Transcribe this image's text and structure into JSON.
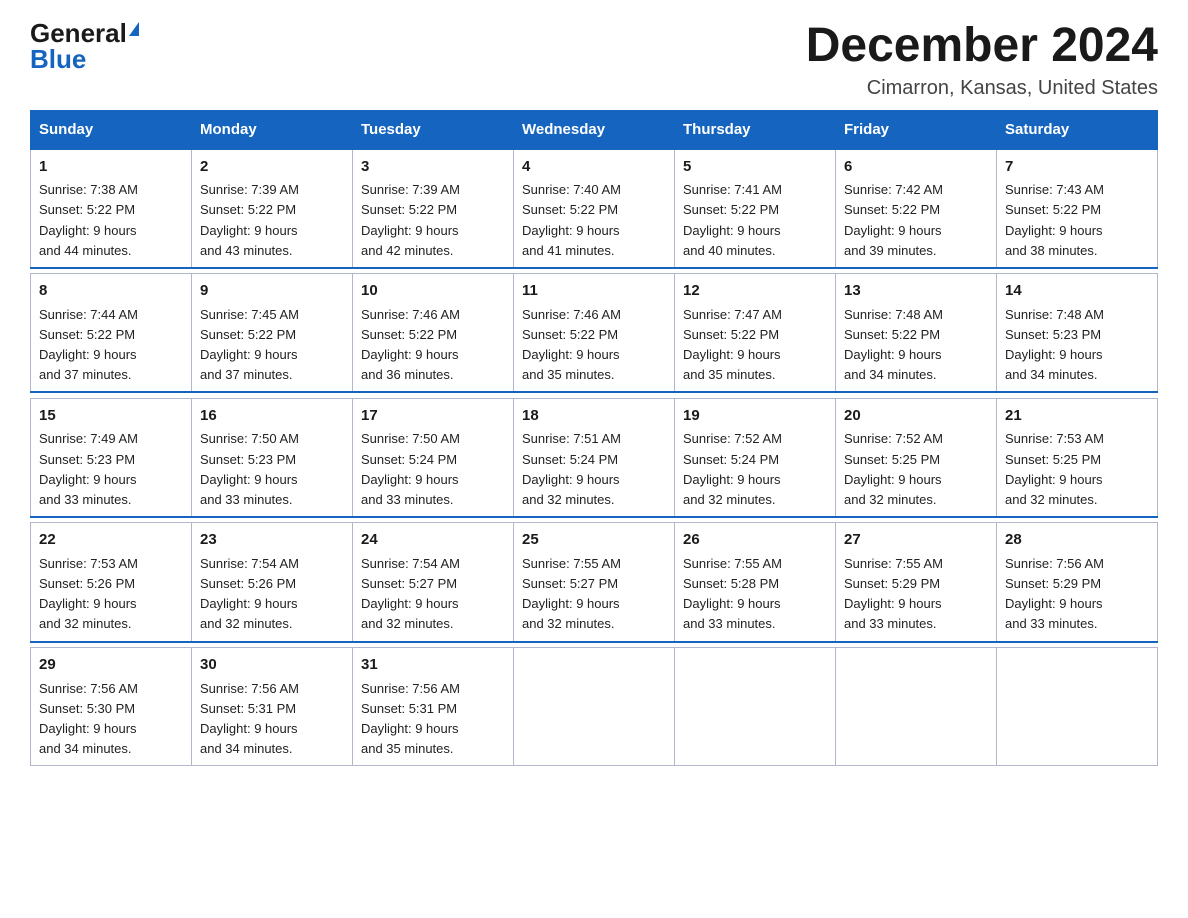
{
  "header": {
    "logo": {
      "general": "General",
      "blue": "Blue"
    },
    "title": "December 2024",
    "location": "Cimarron, Kansas, United States"
  },
  "days_of_week": [
    "Sunday",
    "Monday",
    "Tuesday",
    "Wednesday",
    "Thursday",
    "Friday",
    "Saturday"
  ],
  "weeks": [
    [
      {
        "day": "1",
        "sunrise": "7:38 AM",
        "sunset": "5:22 PM",
        "daylight": "9 hours and 44 minutes."
      },
      {
        "day": "2",
        "sunrise": "7:39 AM",
        "sunset": "5:22 PM",
        "daylight": "9 hours and 43 minutes."
      },
      {
        "day": "3",
        "sunrise": "7:39 AM",
        "sunset": "5:22 PM",
        "daylight": "9 hours and 42 minutes."
      },
      {
        "day": "4",
        "sunrise": "7:40 AM",
        "sunset": "5:22 PM",
        "daylight": "9 hours and 41 minutes."
      },
      {
        "day": "5",
        "sunrise": "7:41 AM",
        "sunset": "5:22 PM",
        "daylight": "9 hours and 40 minutes."
      },
      {
        "day": "6",
        "sunrise": "7:42 AM",
        "sunset": "5:22 PM",
        "daylight": "9 hours and 39 minutes."
      },
      {
        "day": "7",
        "sunrise": "7:43 AM",
        "sunset": "5:22 PM",
        "daylight": "9 hours and 38 minutes."
      }
    ],
    [
      {
        "day": "8",
        "sunrise": "7:44 AM",
        "sunset": "5:22 PM",
        "daylight": "9 hours and 37 minutes."
      },
      {
        "day": "9",
        "sunrise": "7:45 AM",
        "sunset": "5:22 PM",
        "daylight": "9 hours and 37 minutes."
      },
      {
        "day": "10",
        "sunrise": "7:46 AM",
        "sunset": "5:22 PM",
        "daylight": "9 hours and 36 minutes."
      },
      {
        "day": "11",
        "sunrise": "7:46 AM",
        "sunset": "5:22 PM",
        "daylight": "9 hours and 35 minutes."
      },
      {
        "day": "12",
        "sunrise": "7:47 AM",
        "sunset": "5:22 PM",
        "daylight": "9 hours and 35 minutes."
      },
      {
        "day": "13",
        "sunrise": "7:48 AM",
        "sunset": "5:22 PM",
        "daylight": "9 hours and 34 minutes."
      },
      {
        "day": "14",
        "sunrise": "7:48 AM",
        "sunset": "5:23 PM",
        "daylight": "9 hours and 34 minutes."
      }
    ],
    [
      {
        "day": "15",
        "sunrise": "7:49 AM",
        "sunset": "5:23 PM",
        "daylight": "9 hours and 33 minutes."
      },
      {
        "day": "16",
        "sunrise": "7:50 AM",
        "sunset": "5:23 PM",
        "daylight": "9 hours and 33 minutes."
      },
      {
        "day": "17",
        "sunrise": "7:50 AM",
        "sunset": "5:24 PM",
        "daylight": "9 hours and 33 minutes."
      },
      {
        "day": "18",
        "sunrise": "7:51 AM",
        "sunset": "5:24 PM",
        "daylight": "9 hours and 32 minutes."
      },
      {
        "day": "19",
        "sunrise": "7:52 AM",
        "sunset": "5:24 PM",
        "daylight": "9 hours and 32 minutes."
      },
      {
        "day": "20",
        "sunrise": "7:52 AM",
        "sunset": "5:25 PM",
        "daylight": "9 hours and 32 minutes."
      },
      {
        "day": "21",
        "sunrise": "7:53 AM",
        "sunset": "5:25 PM",
        "daylight": "9 hours and 32 minutes."
      }
    ],
    [
      {
        "day": "22",
        "sunrise": "7:53 AM",
        "sunset": "5:26 PM",
        "daylight": "9 hours and 32 minutes."
      },
      {
        "day": "23",
        "sunrise": "7:54 AM",
        "sunset": "5:26 PM",
        "daylight": "9 hours and 32 minutes."
      },
      {
        "day": "24",
        "sunrise": "7:54 AM",
        "sunset": "5:27 PM",
        "daylight": "9 hours and 32 minutes."
      },
      {
        "day": "25",
        "sunrise": "7:55 AM",
        "sunset": "5:27 PM",
        "daylight": "9 hours and 32 minutes."
      },
      {
        "day": "26",
        "sunrise": "7:55 AM",
        "sunset": "5:28 PM",
        "daylight": "9 hours and 33 minutes."
      },
      {
        "day": "27",
        "sunrise": "7:55 AM",
        "sunset": "5:29 PM",
        "daylight": "9 hours and 33 minutes."
      },
      {
        "day": "28",
        "sunrise": "7:56 AM",
        "sunset": "5:29 PM",
        "daylight": "9 hours and 33 minutes."
      }
    ],
    [
      {
        "day": "29",
        "sunrise": "7:56 AM",
        "sunset": "5:30 PM",
        "daylight": "9 hours and 34 minutes."
      },
      {
        "day": "30",
        "sunrise": "7:56 AM",
        "sunset": "5:31 PM",
        "daylight": "9 hours and 34 minutes."
      },
      {
        "day": "31",
        "sunrise": "7:56 AM",
        "sunset": "5:31 PM",
        "daylight": "9 hours and 35 minutes."
      },
      null,
      null,
      null,
      null
    ]
  ],
  "labels": {
    "sunrise": "Sunrise: ",
    "sunset": "Sunset: ",
    "daylight": "Daylight: "
  }
}
